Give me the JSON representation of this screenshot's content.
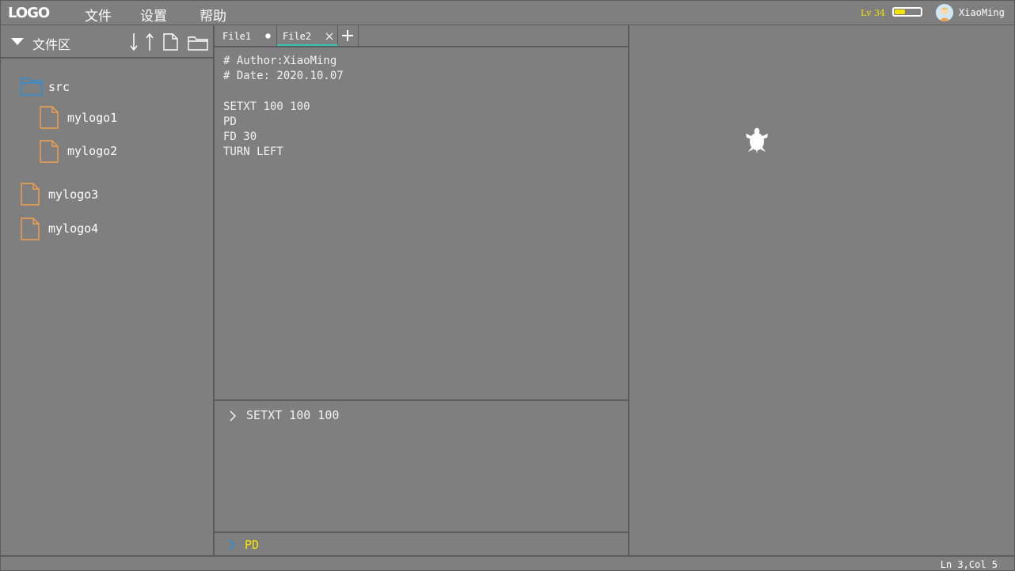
{
  "app": {
    "logo": "LOGO"
  },
  "menu": {
    "file": "文件",
    "settings": "设置",
    "help": "帮助"
  },
  "user": {
    "level": "Lv 34",
    "xp_progress": 0.45,
    "name": "XiaoMing"
  },
  "sidebar": {
    "title": "文件区",
    "tree": {
      "folder": "src",
      "folder_files": [
        "mylogo1",
        "mylogo2"
      ],
      "root_files": [
        "mylogo3",
        "mylogo4"
      ]
    }
  },
  "tabs": [
    {
      "label": "File1",
      "unsaved": true
    },
    {
      "label": "File2",
      "active": true
    }
  ],
  "editor": {
    "code": "# Author:XiaoMing\n# Date: 2020.10.07\n\nSETXT 100 100\nPD\nFD 30\nTURN LEFT"
  },
  "console": {
    "last_command": "SETXT 100 100"
  },
  "command_input": {
    "value": "PD"
  },
  "status": {
    "cursor": "Ln 3,Col 5"
  },
  "colors": {
    "background": "#7f7f7f",
    "divider": "#5c5c5c",
    "folder_icon": "#2f8fd6",
    "file_icon": "#f0a14e",
    "accent_yellow": "#f4e400",
    "active_tab_underline": "#36c2b4"
  }
}
